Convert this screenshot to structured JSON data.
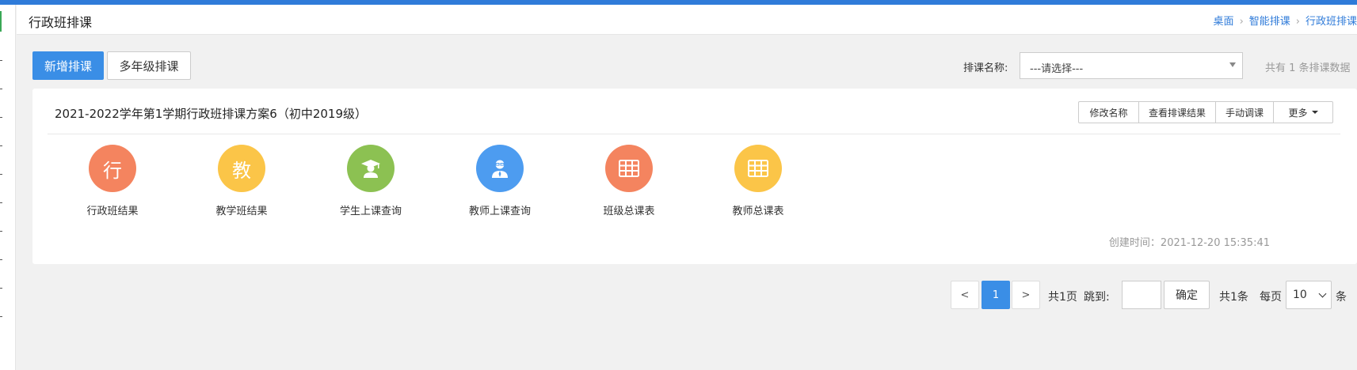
{
  "header": {
    "title": "行政班排课",
    "breadcrumb": [
      "桌面",
      "智能排课",
      "行政班排课"
    ]
  },
  "toolbar": {
    "add_label": "新增排课",
    "multi_grade_label": "多年级排课",
    "filter_label": "排课名称:",
    "select_value": "---请选择---",
    "count_text": "共有 1 条排课数据"
  },
  "card": {
    "title": "2021-2022学年第1学期行政班排课方案6（初中2019级）",
    "actions": [
      "修改名称",
      "查看排课结果",
      "手动调课",
      "更多"
    ],
    "tiles": [
      {
        "label": "行政班结果",
        "glyph": "行",
        "icon": "text-glyph",
        "color": "#f4845f"
      },
      {
        "label": "教学班结果",
        "glyph": "教",
        "icon": "text-glyph",
        "color": "#fbc548"
      },
      {
        "label": "学生上课查询",
        "glyph": "",
        "icon": "student-icon",
        "color": "#8cc152"
      },
      {
        "label": "教师上课查询",
        "glyph": "",
        "icon": "teacher-icon",
        "color": "#4d9cf0"
      },
      {
        "label": "班级总课表",
        "glyph": "",
        "icon": "table-grid-icon",
        "color": "#f4845f"
      },
      {
        "label": "教师总课表",
        "glyph": "",
        "icon": "table-grid-icon",
        "color": "#fbc548"
      }
    ],
    "created": "创建时间：2021-12-20 15:35:41"
  },
  "pagination": {
    "prev": "<",
    "current": "1",
    "next": ">",
    "total_pages": "共1页",
    "jump_label": "跳到:",
    "confirm": "确定",
    "total_items": "共1条",
    "per_page_label": "每页",
    "per_page_value": "10",
    "per_page_unit": "条"
  }
}
